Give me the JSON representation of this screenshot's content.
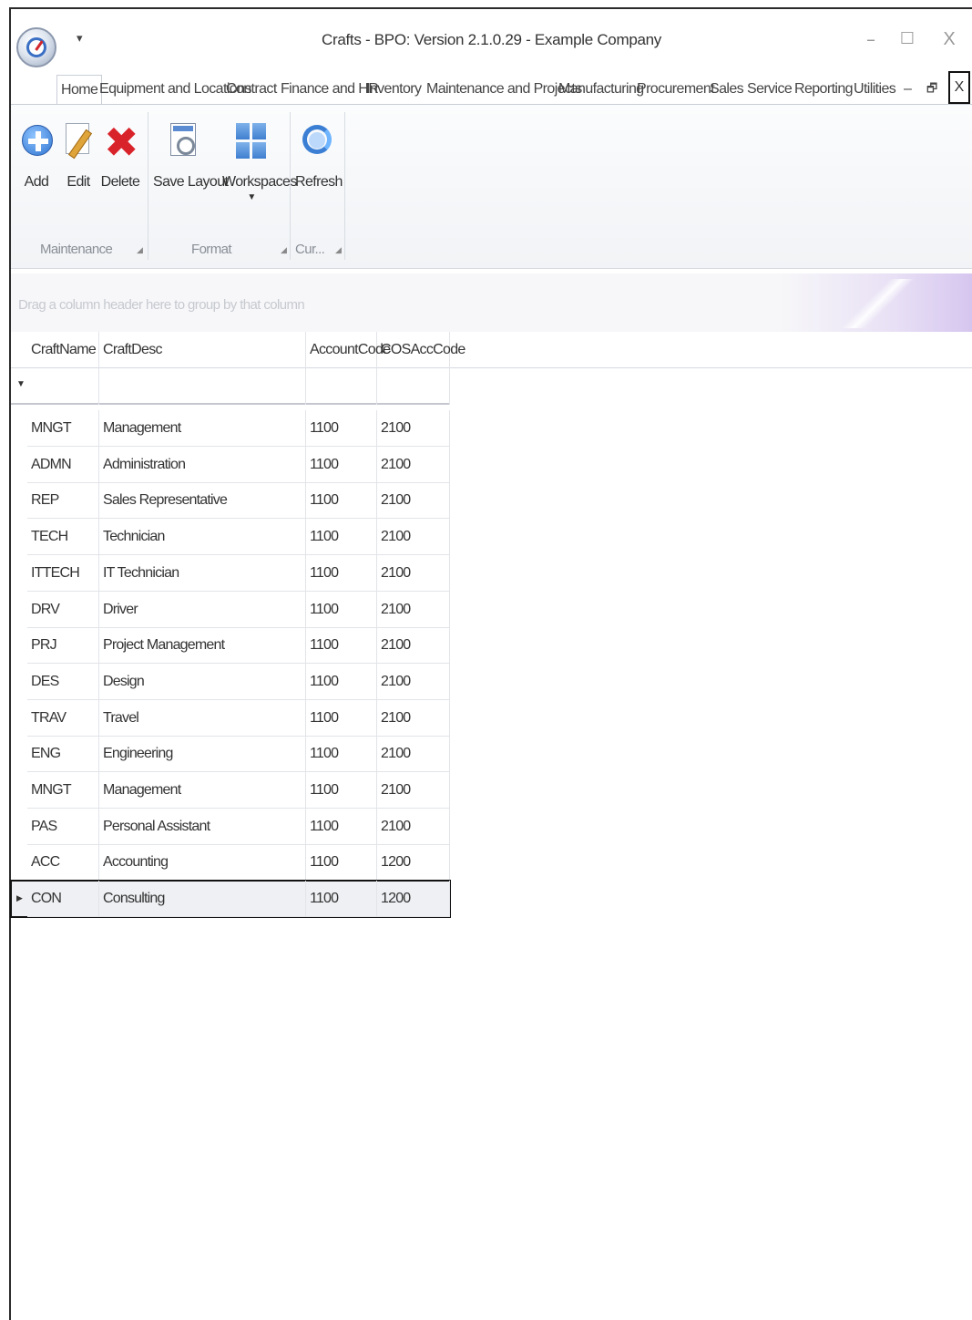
{
  "window": {
    "title": "Crafts - BPO: Version 2.1.0.29 - Example Company",
    "qat_arrow": "▾",
    "controls": {
      "minimize": "–",
      "maximize": "☐",
      "close": "X"
    },
    "mdi": {
      "minimize": "–",
      "restore": "🗗",
      "close": "X"
    }
  },
  "tabs": [
    {
      "label": "Home",
      "active": true
    },
    {
      "label": "Equipment and Locations"
    },
    {
      "label": "Contract"
    },
    {
      "label": "Finance and HR"
    },
    {
      "label": "Inventory"
    },
    {
      "label": "Maintenance and Projects"
    },
    {
      "label": "Manufacturing"
    },
    {
      "label": "Procurement"
    },
    {
      "label": "Sales"
    },
    {
      "label": "Service"
    },
    {
      "label": "Reporting"
    },
    {
      "label": "Utilities"
    }
  ],
  "ribbon": {
    "buttons": {
      "add": "Add",
      "edit": "Edit",
      "delete": "Delete",
      "save_layout": "Save Layout",
      "workspaces": "Workspaces",
      "refresh": "Refresh"
    },
    "groups": {
      "maintenance": "Maintenance",
      "format": "Format",
      "current": "Cur..."
    },
    "icons": [
      "add-icon",
      "edit-icon",
      "delete-icon",
      "save-layout-icon",
      "workspaces-icon",
      "refresh-icon"
    ]
  },
  "grid": {
    "group_hint": "Drag a column header here to group by that column",
    "columns": [
      "CraftName",
      "CraftDesc",
      "AccountCode",
      "COSAccCode"
    ],
    "rows": [
      [
        "MNGT",
        "Management",
        "1100",
        "2100"
      ],
      [
        "ADMN",
        "Administration",
        "1100",
        "2100"
      ],
      [
        "REP",
        "Sales Representative",
        "1100",
        "2100"
      ],
      [
        "TECH",
        "Technician",
        "1100",
        "2100"
      ],
      [
        "ITTECH",
        "IT Technician",
        "1100",
        "2100"
      ],
      [
        "DRV",
        "Driver",
        "1100",
        "2100"
      ],
      [
        "PRJ",
        "Project Management",
        "1100",
        "2100"
      ],
      [
        "DES",
        "Design",
        "1100",
        "2100"
      ],
      [
        "TRAV",
        "Travel",
        "1100",
        "2100"
      ],
      [
        "ENG",
        "Engineering",
        "1100",
        "2100"
      ],
      [
        "MNGT",
        "Management",
        "1100",
        "2100"
      ],
      [
        "PAS",
        "Personal Assistant",
        "1100",
        "2100"
      ],
      [
        "ACC",
        "Accounting",
        "1100",
        "1200"
      ],
      [
        "CON",
        "Consulting",
        "1100",
        "1200"
      ]
    ],
    "selected_row": 13
  },
  "colors": {
    "accent": "#3b7fd4",
    "delete": "#d9232a",
    "selection_border": "#111111"
  }
}
